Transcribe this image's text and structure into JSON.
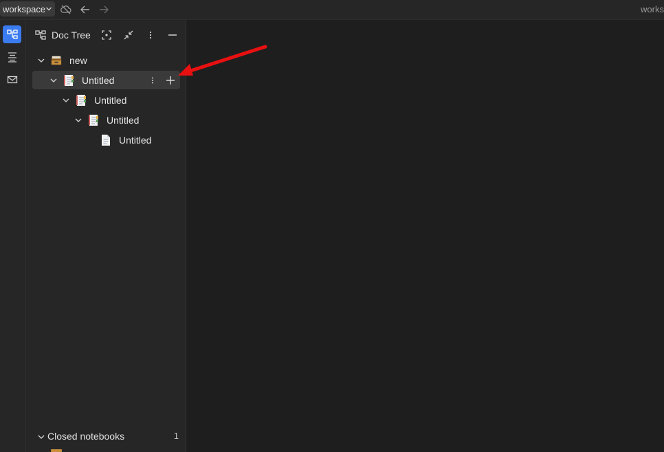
{
  "topbar": {
    "workspace_label": "workspace",
    "window_title_fragment": "works"
  },
  "rail": {
    "items": [
      {
        "icon": "doc-tree-icon",
        "active": true
      },
      {
        "icon": "outline-icon",
        "active": false
      },
      {
        "icon": "inbox-icon",
        "active": false
      }
    ]
  },
  "panel": {
    "title": "Doc Tree",
    "notebook": {
      "name": "new",
      "icon": "notebook-box-icon"
    },
    "tree": [
      {
        "label": "Untitled",
        "depth": 1,
        "expanded": true,
        "selected": true
      },
      {
        "label": "Untitled",
        "depth": 2,
        "expanded": true,
        "selected": false
      },
      {
        "label": "Untitled",
        "depth": 3,
        "expanded": true,
        "selected": false
      },
      {
        "label": "Untitled",
        "depth": 4,
        "expanded": false,
        "selected": false
      }
    ],
    "closed_notebooks": {
      "label": "Closed notebooks",
      "count": "1"
    }
  },
  "colors": {
    "accent": "#3b7bf0",
    "annotation_arrow": "#e81010",
    "background": "#1e1e1e",
    "panel": "#262626"
  }
}
